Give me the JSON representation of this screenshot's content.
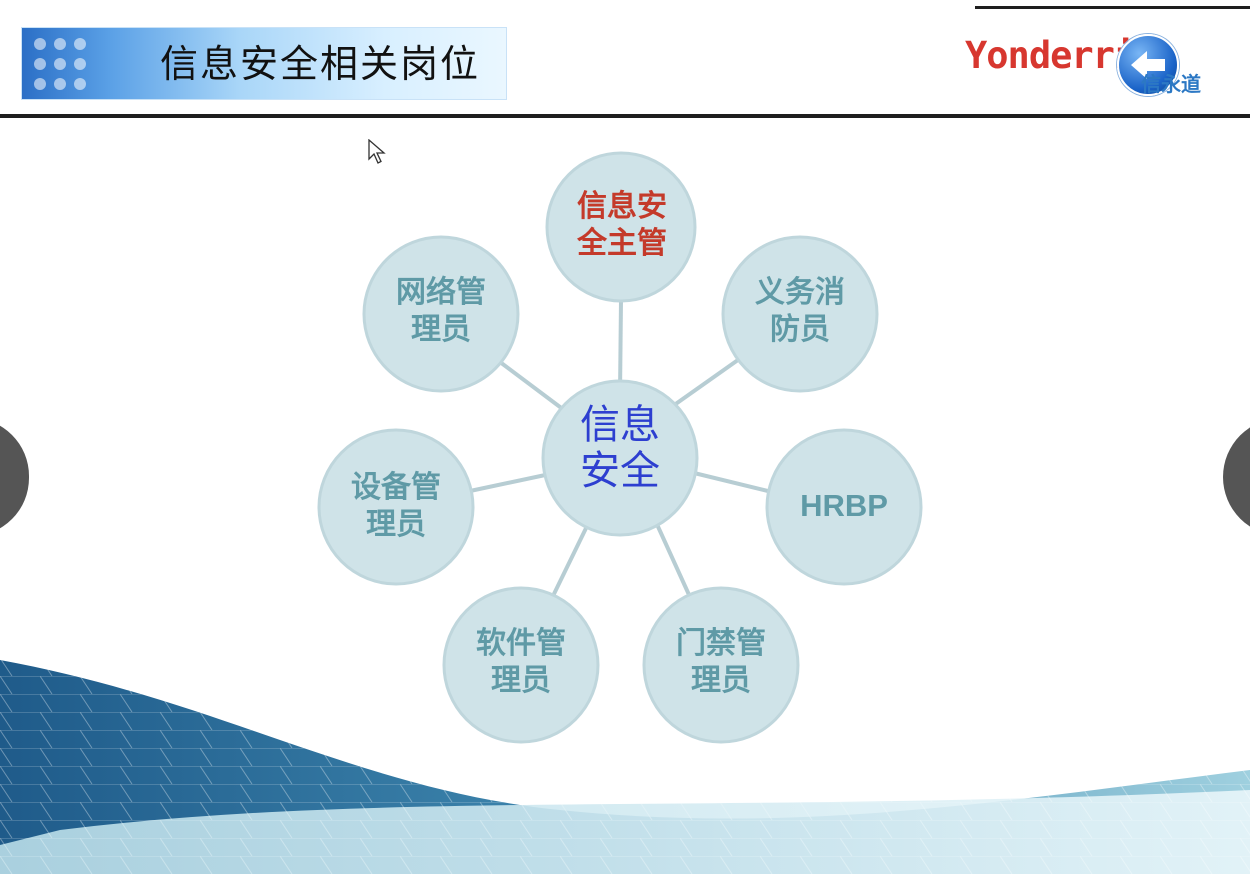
{
  "slide": {
    "title": "信息安全相关岗位",
    "logo": {
      "english": "Yonderrion",
      "chinese": "信永道",
      "brand_color": "#d7372f",
      "accent_color": "#2c78c4"
    }
  },
  "diagram": {
    "center": {
      "label_line1": "信息",
      "label_line2": "安全",
      "color": "#2d3fd0"
    },
    "nodes": [
      {
        "id": "node-infosec-supervisor",
        "line1": "信息安",
        "line2": "全主管",
        "color": "#c43a2a"
      },
      {
        "id": "node-volunteer-firefighter",
        "line1": "义务消",
        "line2": "防员",
        "color": "#5f9aa6"
      },
      {
        "id": "node-hrbp",
        "line1": "HRBP",
        "line2": "",
        "color": "#5f9aa6"
      },
      {
        "id": "node-access-control-admin",
        "line1": "门禁管",
        "line2": "理员",
        "color": "#5f9aa6"
      },
      {
        "id": "node-software-admin",
        "line1": "软件管",
        "line2": "理员",
        "color": "#5f9aa6"
      },
      {
        "id": "node-device-admin",
        "line1": "设备管",
        "line2": "理员",
        "color": "#5f9aa6"
      },
      {
        "id": "node-network-admin",
        "line1": "网络管",
        "line2": "理员",
        "color": "#5f9aa6"
      }
    ],
    "bubble_fill": "#cfe3e8",
    "connector_color": "#b7cdd3"
  },
  "navigation": {
    "prev_icon": "chevron-left-icon",
    "next_icon": "chevron-right-icon"
  }
}
